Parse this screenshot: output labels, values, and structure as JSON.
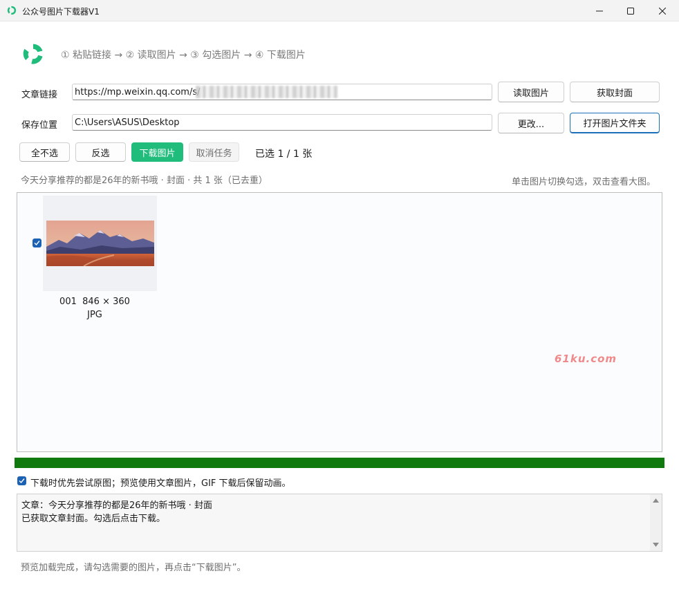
{
  "window": {
    "title": "公众号图片下载器V1",
    "minimize_icon": "minimize-icon",
    "maximize_icon": "maximize-icon",
    "close_icon": "close-icon"
  },
  "header": {
    "logo_icon": "app-logo-icon",
    "steps": "① 粘贴链接 → ② 读取图片 → ③ 勾选图片 → ④ 下载图片"
  },
  "form": {
    "url_label": "文章链接",
    "url_value": "https://mp.weixin.qq.com/s/",
    "read_button": "读取图片",
    "cover_button": "获取封面",
    "save_label": "保存位置",
    "save_value": "C:\\Users\\ASUS\\Desktop",
    "change_button": "更改...",
    "open_folder_button": "打开图片文件夹"
  },
  "toolbar": {
    "deselect_all": "全不选",
    "invert": "反选",
    "download": "下载图片",
    "cancel_task": "取消任务",
    "selected_count": "已选 1 / 1 张"
  },
  "article_info": "今天分享推荐的都是26年的新书哦 · 封面 · 共 1 张（已去重）",
  "gallery_hint": "单击图片切换勾选，双击查看大图。",
  "images": [
    {
      "index": "001",
      "dimensions": "846 × 360",
      "format": "JPG",
      "selected": true
    }
  ],
  "watermark": "61ku.com",
  "progress": {
    "percent": 100,
    "color": "#117a0e"
  },
  "options": {
    "prefer_original_label": "下载时优先尝试原图；预览使用文章图片，GIF 下载后保留动画。",
    "prefer_original_checked": true
  },
  "log": [
    "文章：今天分享推荐的都是26年的新书哦 · 封面",
    "已获取文章封面。勾选后点击下载。"
  ],
  "status_bar": "预览加载完成，请勾选需要的图片，再点击“下载图片”。",
  "colors": {
    "accent_green": "#1fbc7b",
    "checkbox_blue": "#1b62b5",
    "progress_green": "#117a0e"
  }
}
